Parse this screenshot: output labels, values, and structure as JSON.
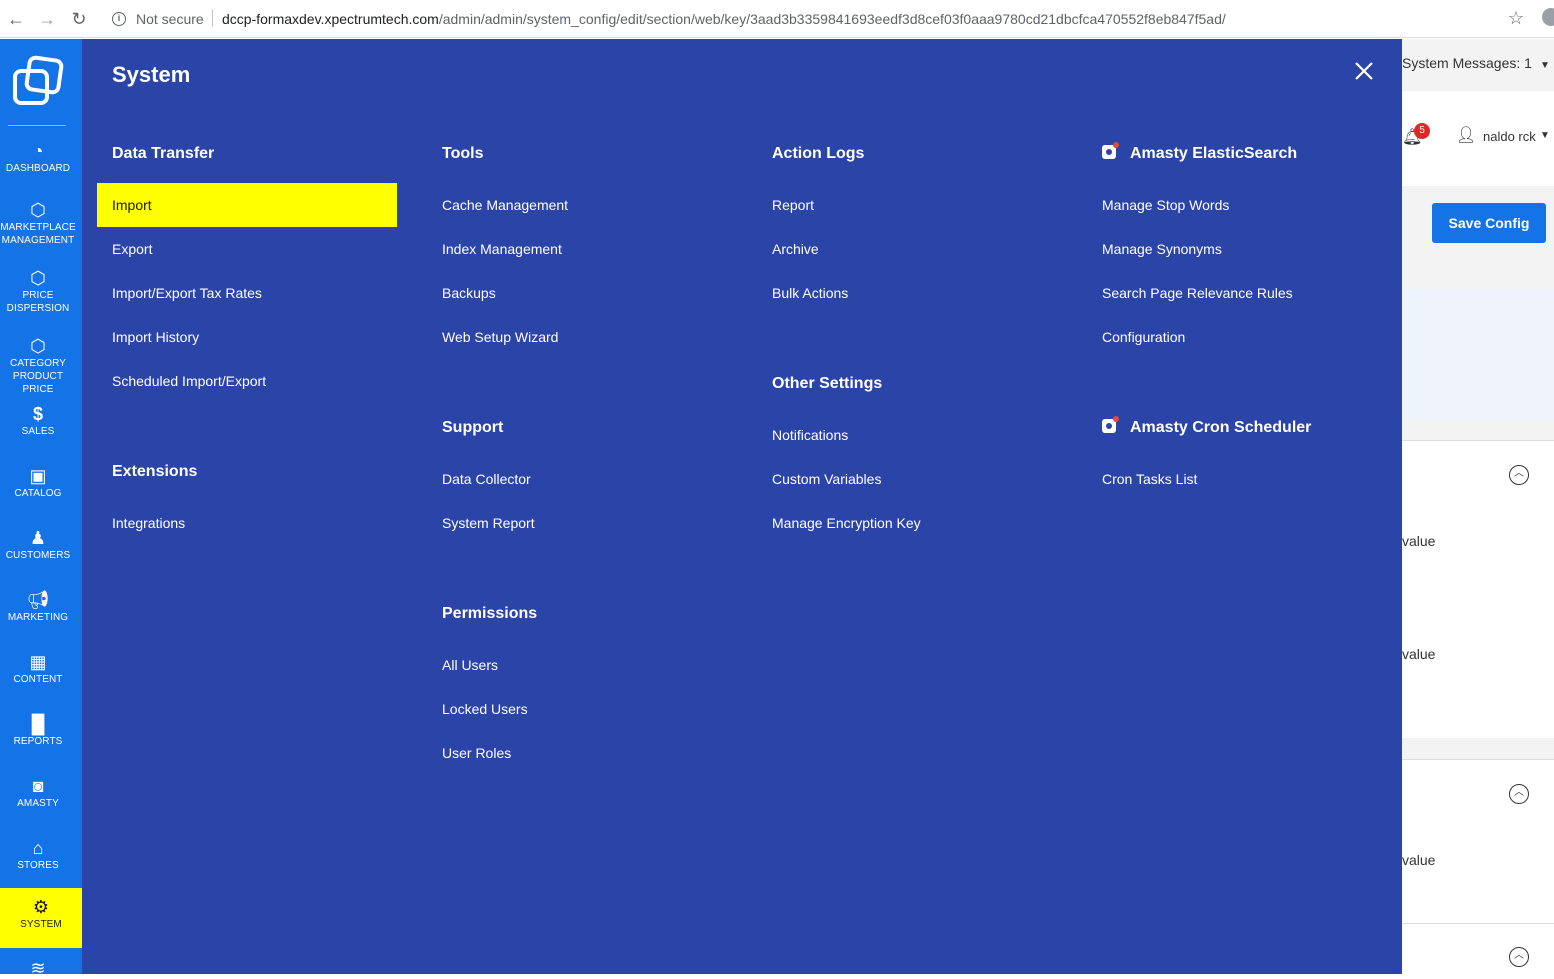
{
  "browser": {
    "security_label": "Not secure",
    "url_host": "dccp-formaxdev.xpectrumtech.com",
    "url_path": "/admin/admin/system_config/edit/section/web/key/3aad3b3359841693eedf3d8cef03f0aaa9780cd21dbcfca470552f8eb847f5ad/"
  },
  "sidebar": {
    "items": [
      {
        "label": "DASHBOARD",
        "icon": "dashboard-icon"
      },
      {
        "label": "MARKETPLACE MANAGEMENT",
        "icon": "hexagon-icon"
      },
      {
        "label": "PRICE DISPERSION",
        "icon": "hexagon-icon"
      },
      {
        "label": "CATEGORY PRODUCT PRICE",
        "icon": "hexagon-icon"
      },
      {
        "label": "SALES",
        "icon": "dollar-icon"
      },
      {
        "label": "CATALOG",
        "icon": "box-icon"
      },
      {
        "label": "CUSTOMERS",
        "icon": "person-icon"
      },
      {
        "label": "MARKETING",
        "icon": "megaphone-icon"
      },
      {
        "label": "CONTENT",
        "icon": "layout-icon"
      },
      {
        "label": "REPORTS",
        "icon": "bar-chart-icon"
      },
      {
        "label": "AMASTY",
        "icon": "amasty-icon"
      },
      {
        "label": "STORES",
        "icon": "storefront-icon"
      },
      {
        "label": "SYSTEM",
        "icon": "gear-icon"
      }
    ]
  },
  "header": {
    "system_messages": "System Messages: 1",
    "notification_count": "5",
    "user_name": "naldo rck",
    "save_button": "Save Config"
  },
  "behind_content": {
    "value_1": "value",
    "value_2": "value",
    "value_3": "value"
  },
  "flyout": {
    "title": "System",
    "columns": [
      {
        "groups": [
          {
            "title": "Data Transfer",
            "items": [
              "Import",
              "Export",
              "Import/Export Tax Rates",
              "Import History",
              "Scheduled Import/Export"
            ]
          },
          {
            "title": "Extensions",
            "items": [
              "Integrations"
            ]
          }
        ]
      },
      {
        "groups": [
          {
            "title": "Tools",
            "items": [
              "Cache Management",
              "Index Management",
              "Backups",
              "Web Setup Wizard"
            ]
          },
          {
            "title": "Support",
            "items": [
              "Data Collector",
              "System Report"
            ]
          },
          {
            "title": "Permissions",
            "items": [
              "All Users",
              "Locked Users",
              "User Roles"
            ]
          }
        ]
      },
      {
        "groups": [
          {
            "title": "Action Logs",
            "items": [
              "Report",
              "Archive",
              "Bulk Actions"
            ]
          },
          {
            "title": "Other Settings",
            "items": [
              "Notifications",
              "Custom Variables",
              "Manage Encryption Key"
            ]
          }
        ]
      },
      {
        "groups": [
          {
            "title": "Amasty ElasticSearch",
            "items": [
              "Manage Stop Words",
              "Manage Synonyms",
              "Search Page Relevance Rules",
              "Configuration"
            ]
          },
          {
            "title": "Amasty Cron Scheduler",
            "items": [
              "Cron Tasks List"
            ]
          }
        ]
      }
    ]
  },
  "colors": {
    "sidebar_blue": "#1473e6",
    "flyout_blue": "#2b44a8",
    "highlight_yellow": "#ffff00"
  }
}
